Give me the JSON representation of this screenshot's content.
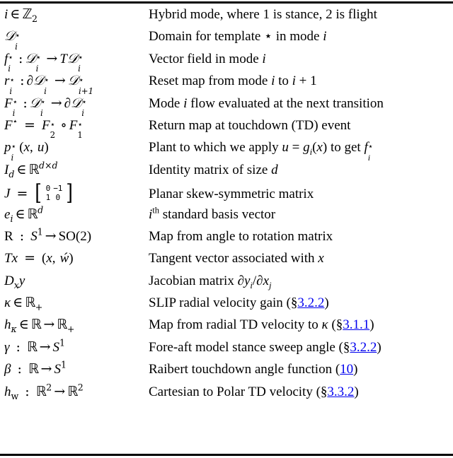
{
  "document": {
    "type": "nomenclature-table",
    "columns": [
      "symbol",
      "description"
    ],
    "link_color": "#0000ee",
    "text_color": "#000000",
    "rule_color": "#000000"
  },
  "rows": [
    {
      "symbol_text": "i ∈ ℤ₂",
      "description_text": "Hybrid mode, where 1 is stance, 2 is flight",
      "reference": null
    },
    {
      "symbol_text": "𝒟ᵢ⋆",
      "description_text": "Domain for template ⋆ in mode i",
      "reference": null
    },
    {
      "symbol_text": "fᵢ⋆ : 𝒟ᵢ⋆ → T𝒟ᵢ⋆",
      "description_text": "Vector field in mode i",
      "reference": null
    },
    {
      "symbol_text": "rᵢ⋆ : ∂𝒟ᵢ⋆ → 𝒟ᵢ₊₁⋆",
      "description_text": "Reset map from mode i to i + 1",
      "reference": null
    },
    {
      "symbol_text": "Fᵢ⋆ : 𝒟ᵢ⋆ → ∂𝒟ᵢ⋆",
      "description_text": "Mode i flow evaluated at the next transition",
      "reference": null
    },
    {
      "symbol_text": "F⋆ = F₂⋆ ∘ F₁⋆",
      "description_text": "Return map at touchdown (TD) event",
      "reference": null
    },
    {
      "symbol_text": "pᵢ⋆(x, u)",
      "description_text": "Plant to which we apply u = gᵢ(x) to get fᵢ⋆",
      "reference": null
    },
    {
      "symbol_text": "I_d ∈ ℝ^{d×d}",
      "description_text": "Identity matrix of size d",
      "reference": null
    },
    {
      "symbol_text": "J = [0 -1; 1 0]",
      "description_text": "Planar skew-symmetric matrix",
      "reference": null
    },
    {
      "symbol_text": "eᵢ ∈ ℝ^d",
      "description_text": "iᵗʰ standard basis vector",
      "reference": null
    },
    {
      "symbol_text": "R : S¹ → SO(2)",
      "description_text": "Map from angle to rotation matrix",
      "reference": null
    },
    {
      "symbol_text": "Tx = (x, ẋ)",
      "description_text": "Tangent vector associated with x",
      "reference": null
    },
    {
      "symbol_text": "Dₓy",
      "description_text": "Jacobian matrix ∂yᵢ/∂xⱼ",
      "reference": null
    },
    {
      "symbol_text": "κ ∈ ℝ₊",
      "description_text": "SLIP radial velocity gain",
      "reference": "§3.2.2"
    },
    {
      "symbol_text": "h_κ ∈ ℝ → ℝ₊",
      "description_text": "Map from radial TD velocity to κ",
      "reference": "§3.1.1"
    },
    {
      "symbol_text": "γ : ℝ → S¹",
      "description_text": "Fore-aft model stance sweep angle",
      "reference": "§3.2.2"
    },
    {
      "symbol_text": "β : ℝ → S¹",
      "description_text": "Raibert touchdown angle function",
      "reference": "10"
    },
    {
      "symbol_text": "h_w : ℝ² → ℝ²",
      "description_text": "Cartesian to Polar TD velocity",
      "reference": "§3.3.2"
    }
  ],
  "descriptions": {
    "d0": "Hybrid mode, where 1 is stance, 2 is flight",
    "d1_a": "Domain for template",
    "d1_b": "in mode",
    "d2_a": "Vector field in mode",
    "d3_a": "Reset map from mode",
    "d3_b": "to",
    "d4_a": "Mode",
    "d4_b": "flow evaluated at the next transition",
    "d5": "Return map at touchdown (TD) event",
    "d6_a": "Plant to which we apply",
    "d6_b": "to get",
    "d7_a": "Identity matrix of size",
    "d8": "Planar skew-symmetric matrix",
    "d9_b": "standard basis vector",
    "d10": "Map from angle to rotation matrix",
    "d11_a": "Tangent vector associated with",
    "d12_a": "Jacobian matrix",
    "d13_a": "SLIP radial velocity gain",
    "d14_a": "Map from radial TD velocity to",
    "d15_a": "Fore-aft model stance sweep angle",
    "d16_a": "Raibert touchdown angle function",
    "d17_a": "Cartesian to Polar TD velocity"
  },
  "refs": {
    "r13": "3.2.2",
    "r14": "3.1.1",
    "r15": "3.2.2",
    "r16": "10",
    "r17": "3.3.2",
    "section_mark": "§"
  },
  "glyphs": {
    "in": "∈",
    "arrow": "→",
    "partial": "∂",
    "circ": "∘",
    "eq": "=",
    "colon": ":",
    "star": "⋆",
    "times": "×",
    "plus": "+",
    "lparen": "(",
    "rparen": ")",
    "comma": ",",
    "slash": "/",
    "Z": "ℤ",
    "R": "ℝ",
    "D": "𝒟",
    "kappa": "κ",
    "gamma": "γ",
    "beta": "β",
    "one": "1",
    "two": "2",
    "th": "th"
  }
}
